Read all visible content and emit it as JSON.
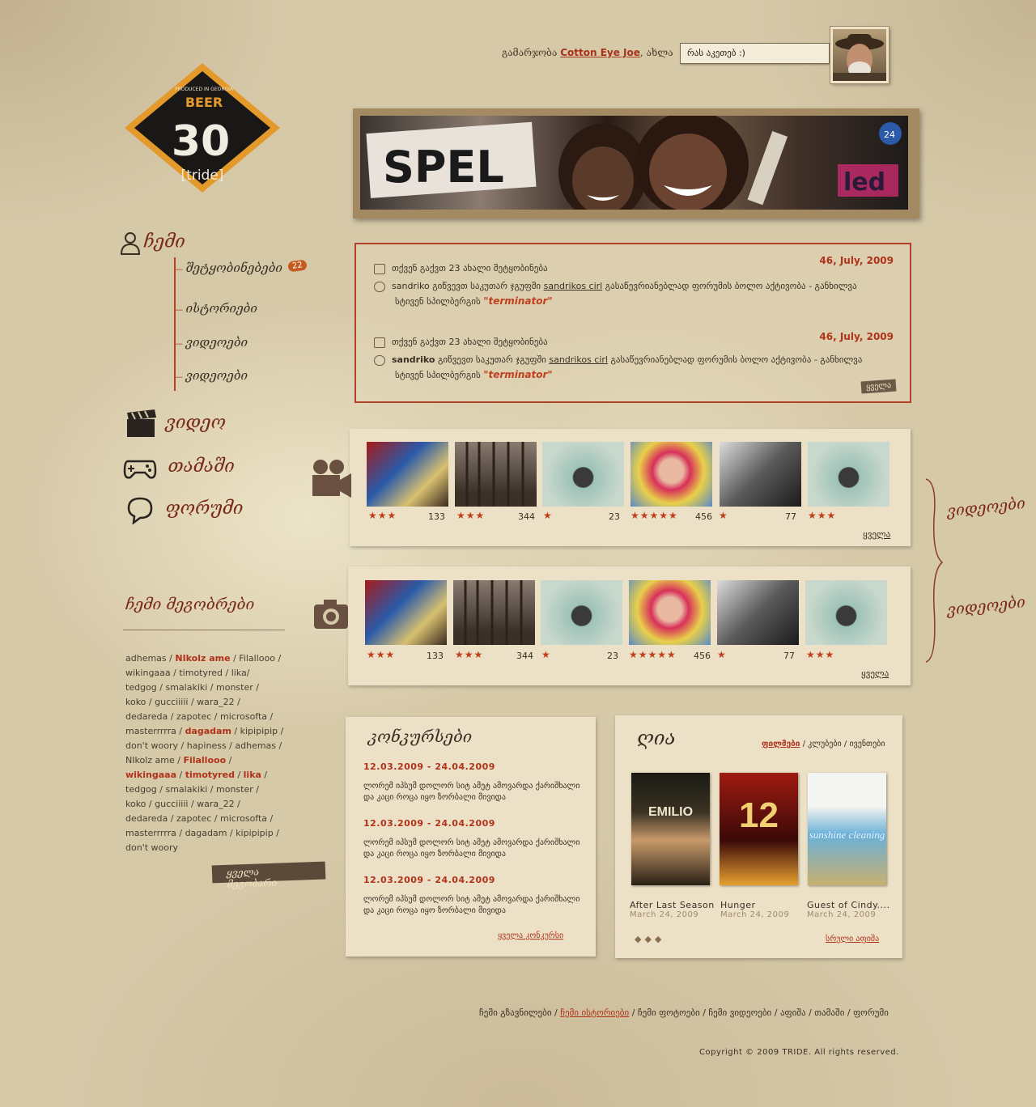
{
  "logo": {
    "number": "30",
    "brand": "[tride]",
    "tag": "BEER",
    "small": "PRODUCED IN GEORGIA"
  },
  "header": {
    "greeting_prefix": "გამარჯობა",
    "user_name": "Cotton Eye Joe",
    "greeting_suffix": ", ახლა",
    "status_placeholder": "რას აკეთებ :)"
  },
  "nav": {
    "profile": "ჩემი",
    "sub_items": [
      {
        "label": "შეტყობინებები",
        "badge": "22"
      },
      {
        "label": "ისტორიები"
      },
      {
        "label": "ვიდეოები"
      },
      {
        "label": "ვიდეოები"
      }
    ],
    "main_items": [
      {
        "label": "ვიდეო",
        "icon": "clapperboard-icon"
      },
      {
        "label": "თამაში",
        "icon": "gamepad-icon"
      },
      {
        "label": "ფორუმი",
        "icon": "chat-bubble-icon"
      }
    ]
  },
  "friends": {
    "title": "ჩემი მეგობრები",
    "all_link": "ყველა მეგობარი"
  },
  "notifications": {
    "groups": [
      {
        "date": "46, July, 2009",
        "messages_text": "თქვენ გაქვთ 23 ახალი შეტყობინება",
        "invite_user": "sandriko",
        "invite_text": "გიწვევთ საკუთარ ჯგუფში",
        "group_name": "sandrikos cirl",
        "invite_rest": "გასაწევრიანებლად  ფორუმის ბოლო აქტივობა - განხილვა",
        "topic_prefix": "სტივენ სპილბერგის",
        "topic": "\"terminator\""
      },
      {
        "date": "46, July, 2009",
        "messages_text": "თქვენ გაქვთ 23 ახალი შეტყობინება",
        "invite_user": "sandriko",
        "invite_text": "გიწვევთ საკუთარ ჯგუფში",
        "group_name": "sandrikos cirl",
        "invite_rest": "გასაწევრიანებლად  ფორუმის ბოლო აქტივობა - განხილვა",
        "topic_prefix": "სტივენ სპილბერგის",
        "topic": "\"terminator\""
      }
    ],
    "all_link": "ყველა"
  },
  "video_panels": [
    {
      "side_label": "ვიდეოები",
      "items": [
        {
          "rating": 3,
          "count": "133"
        },
        {
          "rating": 3,
          "count": "344"
        },
        {
          "rating": 1,
          "count": "23"
        },
        {
          "rating": 5,
          "count": "456"
        },
        {
          "rating": 1,
          "count": "77"
        },
        {
          "rating": 3,
          "count": ""
        }
      ],
      "all_link": "ყველა"
    },
    {
      "side_label": "ვიდეოები",
      "items": [
        {
          "rating": 3,
          "count": "133"
        },
        {
          "rating": 3,
          "count": "344"
        },
        {
          "rating": 1,
          "count": "23"
        },
        {
          "rating": 5,
          "count": "456"
        },
        {
          "rating": 1,
          "count": "77"
        },
        {
          "rating": 3,
          "count": ""
        }
      ],
      "all_link": "ყველა"
    }
  ],
  "contests": {
    "title": "კონკურსები",
    "items": [
      {
        "date": "12.03.2009 - 24.04.2009",
        "text": "ლორემ იპსუმ დოლორ სიტ ამეტ ამოვარდა ქარიშხალი და კაცი როცა იყო ზორბალი მივიდა"
      },
      {
        "date": "12.03.2009 - 24.04.2009",
        "text": "ლორემ იპსუმ დოლორ სიტ ამეტ ამოვარდა ქარიშხალი და კაცი როცა იყო ზორბალი მივიდა"
      },
      {
        "date": "12.03.2009 - 24.04.2009",
        "text": "ლორემ იპსუმ დოლორ სიტ ამეტ ამოვარდა ქარიშხალი და კაცი როცა იყო ზორბალი მივიდა"
      }
    ],
    "all_link": "ყველა კონკურსი"
  },
  "poster": {
    "title": "ღია",
    "tabs": [
      "ფილმები",
      "კლუბები",
      "ივენთები"
    ],
    "movies": [
      {
        "title": "After Last Season",
        "date": "March 24, 2009",
        "poster_text": "EMILIO",
        "color": "#2a2418"
      },
      {
        "title": "Hunger",
        "date": "March 24, 2009",
        "poster_text": "12",
        "color": "#8a1a10"
      },
      {
        "title": "Guest of Cindy....",
        "date": "March 24, 2009",
        "poster_text": "sunshine cleaning",
        "color": "#4a8ab0"
      }
    ],
    "full_link": "სრული აფიშა"
  },
  "footer": {
    "links": [
      "ჩემი გზავნილები",
      "ჩემი ისტორიები",
      "ჩემი ფოტოები",
      "ჩემი ვიდეოები",
      "აფიშა",
      "თამაში",
      "ფორუმი"
    ],
    "active_index": 1,
    "copyright": "Copyright © 2009 TRIDE. All rights reserved."
  }
}
